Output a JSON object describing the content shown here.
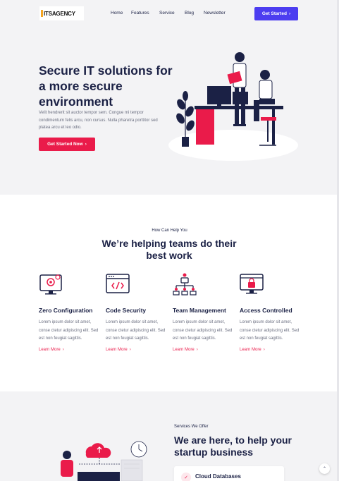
{
  "nav": {
    "logo": "ITSAGENCY",
    "items": [
      "Home",
      "Features",
      "Service",
      "Blog",
      "Newsletter"
    ],
    "cta_label": "Get Started",
    "cta_icon": "chevron-right-icon"
  },
  "hero": {
    "title": "Secure IT solutions for a more secure environment",
    "text": "Velit hendrerit sit auctor tempor sem. Congue mi tempor condimentum felis arcu, non cursus. Nulla pharetra porttitor sed platea arcu et leo odio.",
    "cta_label": "Get Started Now"
  },
  "help": {
    "kicker": "How Can Help You",
    "title": "We’re helping teams do their best work",
    "features": [
      {
        "icon": "gear-monitor-icon",
        "title": "Zero Configuration",
        "text": "Lorem ipsum dolor sit amet, conse ctetur adipiscing elit. Sed est non feugiat sagittis.",
        "link": "Learn More"
      },
      {
        "icon": "code-window-icon",
        "title": "Code Security",
        "text": "Lorem ipsum dolor sit amet, conse ctetur adipiscing elit. Sed est non feugiat sagittis.",
        "link": "Learn More"
      },
      {
        "icon": "team-hierarchy-icon",
        "title": "Team Management",
        "text": "Lorem ipsum dolor sit amet, conse ctetur adipiscing elit. Sed est non feugiat sagittis.",
        "link": "Learn More"
      },
      {
        "icon": "lock-monitor-icon",
        "title": "Access Controlled",
        "text": "Lorem ipsum dolor sit amet, conse ctetur adipiscing elit. Sed est non feugiat sagittis.",
        "link": "Learn More"
      }
    ]
  },
  "services": {
    "kicker": "Services We Offer",
    "title": "We are here, to help your startup business",
    "card_label": "Cloud Databases",
    "scroll_top_icon": "chevron-up-icon"
  },
  "colors": {
    "primary": "#4c3df0",
    "accent": "#ea1b4a",
    "navy": "#1b2145"
  }
}
